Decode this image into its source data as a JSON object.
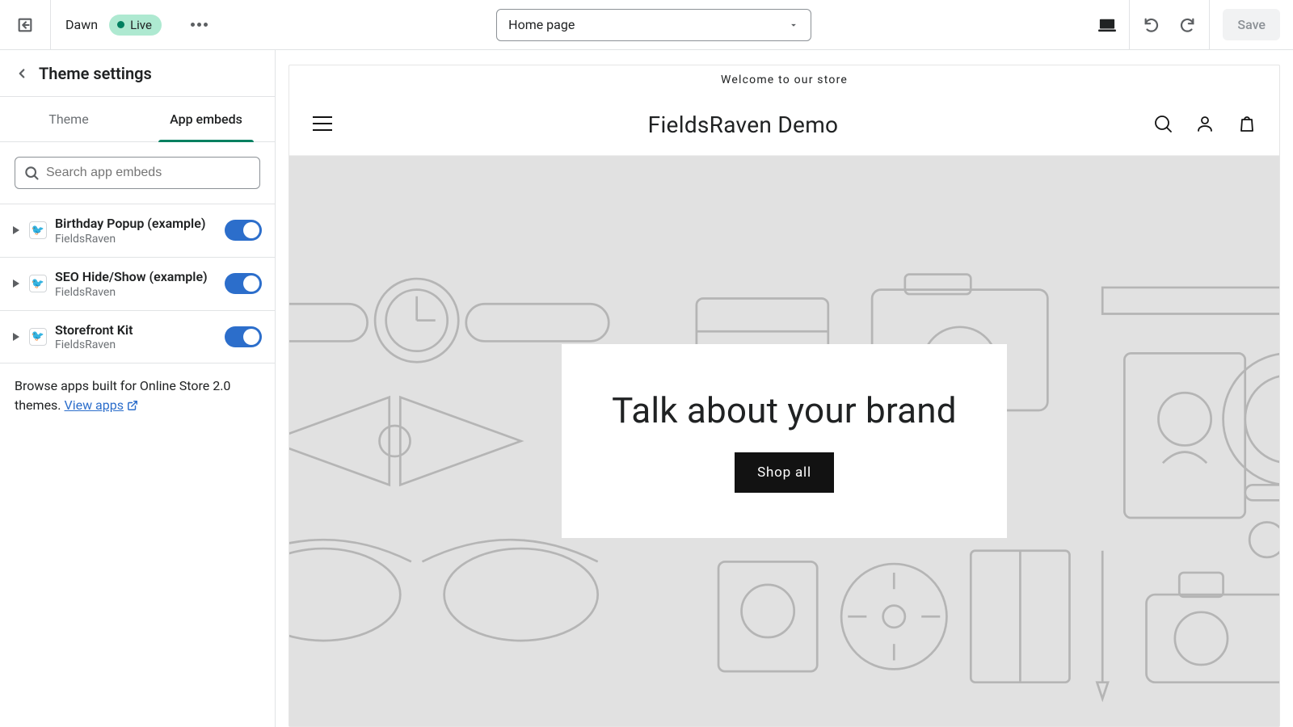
{
  "topbar": {
    "theme_name": "Dawn",
    "live_label": "Live",
    "page_selector": "Home page",
    "save_label": "Save"
  },
  "sidebar": {
    "title": "Theme settings",
    "tabs": {
      "theme": "Theme",
      "app_embeds": "App embeds"
    },
    "search_placeholder": "Search app embeds",
    "embeds": [
      {
        "title": "Birthday Popup (example)",
        "vendor": "FieldsRaven",
        "enabled": true
      },
      {
        "title": "SEO Hide/Show (example)",
        "vendor": "FieldsRaven",
        "enabled": true
      },
      {
        "title": "Storefront Kit",
        "vendor": "FieldsRaven",
        "enabled": true
      }
    ],
    "browse_text_prefix": "Browse apps built for Online Store 2.0 themes. ",
    "browse_link_label": "View apps"
  },
  "preview": {
    "announcement": "Welcome to our store",
    "site_title": "FieldsRaven Demo",
    "hero_heading": "Talk about your brand",
    "hero_button": "Shop all"
  }
}
